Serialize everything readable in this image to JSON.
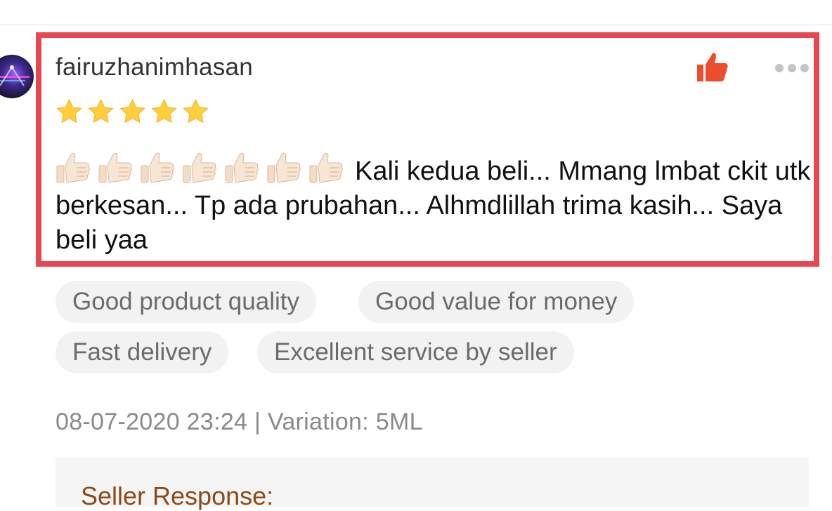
{
  "review": {
    "username": "fairuzhanimhasan",
    "rating": 5,
    "rating_max": 5,
    "emoji": "thumbs-up",
    "emoji_count": 7,
    "text": "Kali kedua beli... Mmang lmbat ckit utk berkesan... Tp ada prubahan... Alhmdlillah trima kasih... Saya beli yaa",
    "tags": [
      "Good product quality",
      "Good value for money",
      "Fast delivery",
      "Excellent service by seller"
    ],
    "meta": "08-07-2020 23:24 | Variation: 5ML",
    "liked": true
  },
  "seller_response": {
    "label": "Seller Response:"
  },
  "colors": {
    "highlight_border": "#e84650",
    "like": "#ee4d2d",
    "star": "#ffce3d",
    "tag_bg": "#f2f2f2",
    "seller_label": "#8b4a17"
  },
  "icons": {
    "like": "thumbs-up-icon",
    "more": "more-options-icon",
    "star": "star-icon"
  }
}
